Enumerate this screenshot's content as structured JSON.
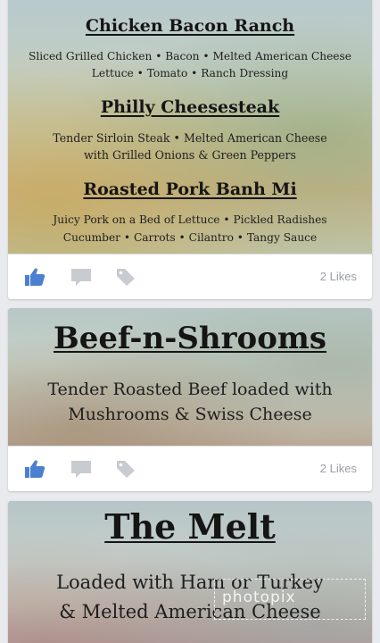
{
  "posts": [
    {
      "items": [
        {
          "title": "Chicken Bacon Ranch",
          "lines": [
            "Sliced Grilled Chicken • Bacon • Melted American Cheese",
            "Lettuce • Tomato • Ranch Dressing"
          ]
        },
        {
          "title": "Philly Cheesesteak",
          "lines": [
            "Tender Sirloin Steak • Melted American Cheese",
            "with Grilled Onions & Green Peppers"
          ]
        },
        {
          "title": "Roasted Pork Banh Mi",
          "lines": [
            "Juicy Pork on a Bed of Lettuce • Pickled Radishes",
            "Cucumber • Carrots • Cilantro • Tangy Sauce"
          ]
        }
      ],
      "likes": "2 Likes"
    },
    {
      "items": [
        {
          "title": "Beef-n-Shrooms",
          "lines": [
            "Tender Roasted Beef loaded with",
            "Mushrooms & Swiss Cheese"
          ]
        }
      ],
      "likes": "2 Likes"
    },
    {
      "items": [
        {
          "title": "The Melt",
          "lines": [
            "Loaded with Ham or Turkey",
            "& Melted American Cheese"
          ]
        }
      ]
    }
  ],
  "watermark": "photopix",
  "colors": {
    "like_blue": "#4b7fd0",
    "icon_gray": "#c8cbd0",
    "likes_text": "#9a9ea5"
  },
  "icons": {
    "like": "thumbs-up-icon",
    "comment": "comment-icon",
    "tag": "tag-icon"
  }
}
